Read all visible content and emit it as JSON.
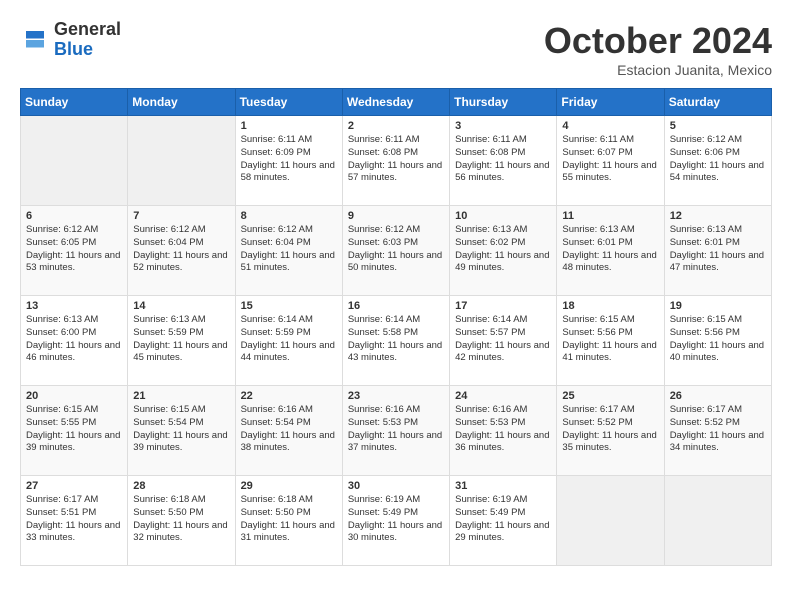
{
  "header": {
    "logo": {
      "general": "General",
      "blue": "Blue"
    },
    "title": "October 2024",
    "location": "Estacion Juanita, Mexico"
  },
  "weekdays": [
    "Sunday",
    "Monday",
    "Tuesday",
    "Wednesday",
    "Thursday",
    "Friday",
    "Saturday"
  ],
  "weeks": [
    [
      {
        "day": "",
        "sunrise": "",
        "sunset": "",
        "daylight": ""
      },
      {
        "day": "",
        "sunrise": "",
        "sunset": "",
        "daylight": ""
      },
      {
        "day": "1",
        "sunrise": "Sunrise: 6:11 AM",
        "sunset": "Sunset: 6:09 PM",
        "daylight": "Daylight: 11 hours and 58 minutes."
      },
      {
        "day": "2",
        "sunrise": "Sunrise: 6:11 AM",
        "sunset": "Sunset: 6:08 PM",
        "daylight": "Daylight: 11 hours and 57 minutes."
      },
      {
        "day": "3",
        "sunrise": "Sunrise: 6:11 AM",
        "sunset": "Sunset: 6:08 PM",
        "daylight": "Daylight: 11 hours and 56 minutes."
      },
      {
        "day": "4",
        "sunrise": "Sunrise: 6:11 AM",
        "sunset": "Sunset: 6:07 PM",
        "daylight": "Daylight: 11 hours and 55 minutes."
      },
      {
        "day": "5",
        "sunrise": "Sunrise: 6:12 AM",
        "sunset": "Sunset: 6:06 PM",
        "daylight": "Daylight: 11 hours and 54 minutes."
      }
    ],
    [
      {
        "day": "6",
        "sunrise": "Sunrise: 6:12 AM",
        "sunset": "Sunset: 6:05 PM",
        "daylight": "Daylight: 11 hours and 53 minutes."
      },
      {
        "day": "7",
        "sunrise": "Sunrise: 6:12 AM",
        "sunset": "Sunset: 6:04 PM",
        "daylight": "Daylight: 11 hours and 52 minutes."
      },
      {
        "day": "8",
        "sunrise": "Sunrise: 6:12 AM",
        "sunset": "Sunset: 6:04 PM",
        "daylight": "Daylight: 11 hours and 51 minutes."
      },
      {
        "day": "9",
        "sunrise": "Sunrise: 6:12 AM",
        "sunset": "Sunset: 6:03 PM",
        "daylight": "Daylight: 11 hours and 50 minutes."
      },
      {
        "day": "10",
        "sunrise": "Sunrise: 6:13 AM",
        "sunset": "Sunset: 6:02 PM",
        "daylight": "Daylight: 11 hours and 49 minutes."
      },
      {
        "day": "11",
        "sunrise": "Sunrise: 6:13 AM",
        "sunset": "Sunset: 6:01 PM",
        "daylight": "Daylight: 11 hours and 48 minutes."
      },
      {
        "day": "12",
        "sunrise": "Sunrise: 6:13 AM",
        "sunset": "Sunset: 6:01 PM",
        "daylight": "Daylight: 11 hours and 47 minutes."
      }
    ],
    [
      {
        "day": "13",
        "sunrise": "Sunrise: 6:13 AM",
        "sunset": "Sunset: 6:00 PM",
        "daylight": "Daylight: 11 hours and 46 minutes."
      },
      {
        "day": "14",
        "sunrise": "Sunrise: 6:13 AM",
        "sunset": "Sunset: 5:59 PM",
        "daylight": "Daylight: 11 hours and 45 minutes."
      },
      {
        "day": "15",
        "sunrise": "Sunrise: 6:14 AM",
        "sunset": "Sunset: 5:59 PM",
        "daylight": "Daylight: 11 hours and 44 minutes."
      },
      {
        "day": "16",
        "sunrise": "Sunrise: 6:14 AM",
        "sunset": "Sunset: 5:58 PM",
        "daylight": "Daylight: 11 hours and 43 minutes."
      },
      {
        "day": "17",
        "sunrise": "Sunrise: 6:14 AM",
        "sunset": "Sunset: 5:57 PM",
        "daylight": "Daylight: 11 hours and 42 minutes."
      },
      {
        "day": "18",
        "sunrise": "Sunrise: 6:15 AM",
        "sunset": "Sunset: 5:56 PM",
        "daylight": "Daylight: 11 hours and 41 minutes."
      },
      {
        "day": "19",
        "sunrise": "Sunrise: 6:15 AM",
        "sunset": "Sunset: 5:56 PM",
        "daylight": "Daylight: 11 hours and 40 minutes."
      }
    ],
    [
      {
        "day": "20",
        "sunrise": "Sunrise: 6:15 AM",
        "sunset": "Sunset: 5:55 PM",
        "daylight": "Daylight: 11 hours and 39 minutes."
      },
      {
        "day": "21",
        "sunrise": "Sunrise: 6:15 AM",
        "sunset": "Sunset: 5:54 PM",
        "daylight": "Daylight: 11 hours and 39 minutes."
      },
      {
        "day": "22",
        "sunrise": "Sunrise: 6:16 AM",
        "sunset": "Sunset: 5:54 PM",
        "daylight": "Daylight: 11 hours and 38 minutes."
      },
      {
        "day": "23",
        "sunrise": "Sunrise: 6:16 AM",
        "sunset": "Sunset: 5:53 PM",
        "daylight": "Daylight: 11 hours and 37 minutes."
      },
      {
        "day": "24",
        "sunrise": "Sunrise: 6:16 AM",
        "sunset": "Sunset: 5:53 PM",
        "daylight": "Daylight: 11 hours and 36 minutes."
      },
      {
        "day": "25",
        "sunrise": "Sunrise: 6:17 AM",
        "sunset": "Sunset: 5:52 PM",
        "daylight": "Daylight: 11 hours and 35 minutes."
      },
      {
        "day": "26",
        "sunrise": "Sunrise: 6:17 AM",
        "sunset": "Sunset: 5:52 PM",
        "daylight": "Daylight: 11 hours and 34 minutes."
      }
    ],
    [
      {
        "day": "27",
        "sunrise": "Sunrise: 6:17 AM",
        "sunset": "Sunset: 5:51 PM",
        "daylight": "Daylight: 11 hours and 33 minutes."
      },
      {
        "day": "28",
        "sunrise": "Sunrise: 6:18 AM",
        "sunset": "Sunset: 5:50 PM",
        "daylight": "Daylight: 11 hours and 32 minutes."
      },
      {
        "day": "29",
        "sunrise": "Sunrise: 6:18 AM",
        "sunset": "Sunset: 5:50 PM",
        "daylight": "Daylight: 11 hours and 31 minutes."
      },
      {
        "day": "30",
        "sunrise": "Sunrise: 6:19 AM",
        "sunset": "Sunset: 5:49 PM",
        "daylight": "Daylight: 11 hours and 30 minutes."
      },
      {
        "day": "31",
        "sunrise": "Sunrise: 6:19 AM",
        "sunset": "Sunset: 5:49 PM",
        "daylight": "Daylight: 11 hours and 29 minutes."
      },
      {
        "day": "",
        "sunrise": "",
        "sunset": "",
        "daylight": ""
      },
      {
        "day": "",
        "sunrise": "",
        "sunset": "",
        "daylight": ""
      }
    ]
  ]
}
